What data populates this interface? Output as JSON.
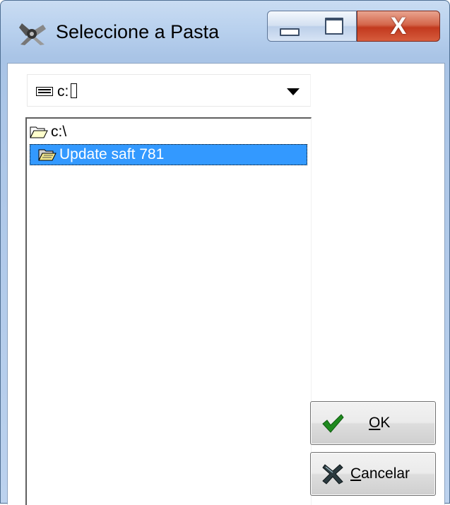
{
  "window": {
    "title": "Seleccione a Pasta",
    "minimize_icon": "minimize-icon",
    "maximize_icon": "maximize-icon",
    "close_glyph": "X"
  },
  "drive": {
    "label": "c:",
    "icon": "drive-icon"
  },
  "folders": [
    {
      "name": "c:\\",
      "icon": "open-folder-icon",
      "selected": false
    },
    {
      "name": "Update saft 781",
      "icon": "open-folder-icon",
      "selected": true
    }
  ],
  "buttons": {
    "ok": {
      "label_accel": "O",
      "label_rest": "K",
      "icon": "checkmark-icon"
    },
    "cancel": {
      "label_accel": "C",
      "label_rest": "ancelar",
      "icon": "x-cross-icon"
    }
  },
  "colors": {
    "selection": "#3399ff",
    "check": "#1f8a1f",
    "close_button": "#c2391e"
  }
}
